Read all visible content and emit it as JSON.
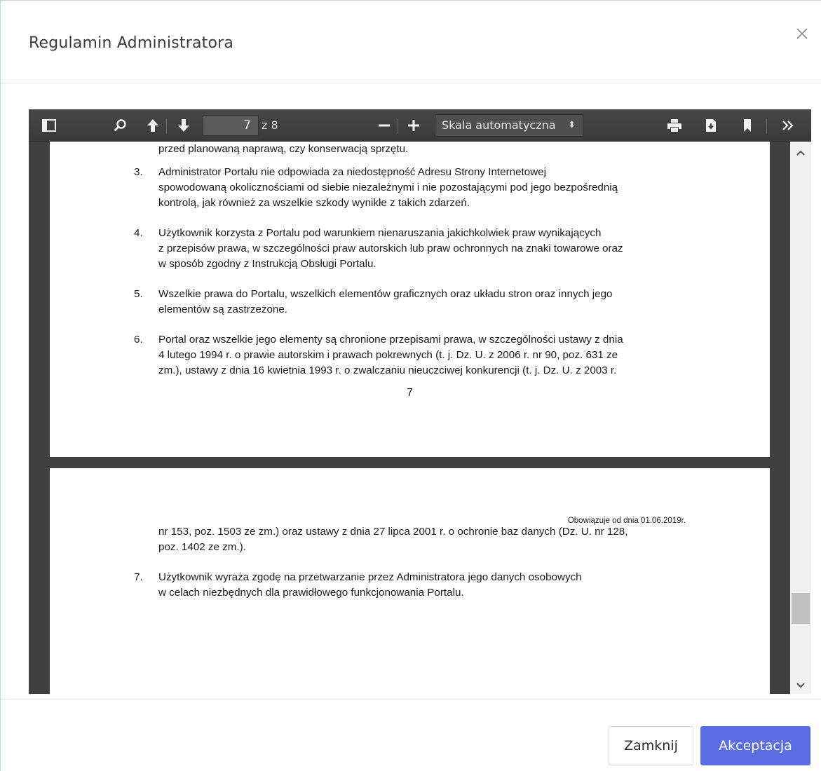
{
  "modal": {
    "title": "Regulamin Administratora",
    "close_icon": "close-icon"
  },
  "toolbar": {
    "sidebar_icon": "sidebar-toggle-icon",
    "search_icon": "search-icon",
    "prev_icon": "arrow-up-icon",
    "next_icon": "arrow-down-icon",
    "page_number": "7",
    "page_total": "z 8",
    "zoom_out_icon": "minus-icon",
    "zoom_in_icon": "plus-icon",
    "scale": "Skala automatyczna",
    "print_icon": "print-icon",
    "download_icon": "download-icon",
    "bookmark_icon": "bookmark-icon",
    "more_icon": "double-chevron-right-icon"
  },
  "document": {
    "page1": {
      "top_line": "przed planowaną naprawą, czy konserwacją sprzętu.",
      "items": [
        {
          "num": "3.",
          "lines": [
            "Administrator Portalu nie odpowiada za niedostępność Adresu Strony Internetowej",
            "spowodowaną okolicznościami od siebie niezależnymi i nie pozostającymi pod jego bezpośrednią",
            "kontrolą, jak również za wszelkie szkody wynikłe z takich zdarzeń."
          ]
        },
        {
          "num": "4.",
          "lines": [
            "Użytkownik korzysta z Portalu pod warunkiem nienaruszania jakichkolwiek praw wynikających",
            "z przepisów prawa, w szczególności praw autorskich lub praw ochronnych na znaki towarowe oraz",
            "w sposób zgodny z Instrukcją Obsługi Portalu."
          ]
        },
        {
          "num": "5.",
          "lines": [
            "Wszelkie prawa do Portalu, wszelkich elementów graficznych oraz układu stron oraz innych jego",
            "elementów są zastrzeżone."
          ]
        },
        {
          "num": "6.",
          "lines": [
            "Portal oraz wszelkie jego elementy są chronione przepisami prawa, w szczególności ustawy z dnia",
            "4 lutego 1994 r. o prawie autorskim i prawach pokrewnych (t. j. Dz. U. z 2006 r. nr 90, poz. 631 ze",
            "zm.), ustawy z dnia 16 kwietnia 1993 r. o zwalczaniu nieuczciwej konkurencji (t. j. Dz. U. z 2003 r."
          ]
        }
      ],
      "page_number": "7"
    },
    "page2": {
      "date_note": "Obowiązuje od dnia 01.06.2019r.",
      "continuation": [
        "nr 153, poz. 1503 ze zm.) oraz ustawy z dnia 27 lipca 2001 r. o ochronie baz danych (Dz. U. nr 128,",
        "poz. 1402 ze zm.)."
      ],
      "items": [
        {
          "num": "7.",
          "lines": [
            "Użytkownik wyraża zgodę na przetwarzanie przez Administratora jego danych osobowych",
            "w celach niezbędnych dla prawidłowego funkcjonowania Portalu."
          ]
        }
      ]
    }
  },
  "footer": {
    "close_label": "Zamknij",
    "accept_label": "Akceptacja",
    "accent_color": "#5b6ee1"
  }
}
